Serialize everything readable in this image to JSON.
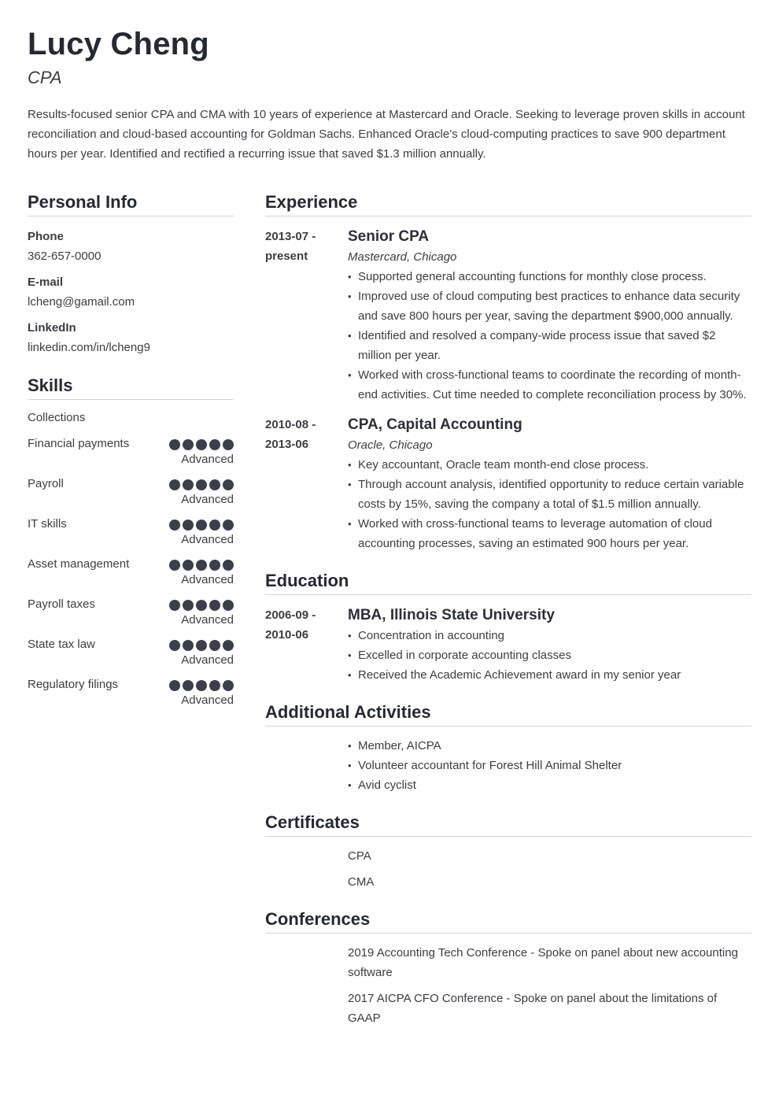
{
  "header": {
    "name": "Lucy Cheng",
    "title": "CPA",
    "summary": "Results-focused senior CPA and CMA with 10 years of experience at Mastercard and Oracle. Seeking to leverage proven skills in account reconciliation and cloud-based accounting for Goldman Sachs. Enhanced Oracle’s cloud-computing practices to save 900 department hours per year. Identified and rectified a recurring issue that saved $1.3 million annually."
  },
  "personal_info": {
    "heading": "Personal Info",
    "items": [
      {
        "label": "Phone",
        "value": "362-657-0000"
      },
      {
        "label": "E-mail",
        "value": "lcheng@gamail.com"
      },
      {
        "label": "LinkedIn",
        "value": "linkedin.com/in/lcheng9"
      }
    ]
  },
  "skills": {
    "heading": "Skills",
    "plain": [
      "Collections"
    ],
    "rated": [
      {
        "name": "Financial payments",
        "level": "Advanced",
        "rating": 5,
        "max": 5
      },
      {
        "name": "Payroll",
        "level": "Advanced",
        "rating": 5,
        "max": 5
      },
      {
        "name": "IT skills",
        "level": "Advanced",
        "rating": 5,
        "max": 5
      },
      {
        "name": "Asset management",
        "level": "Advanced",
        "rating": 5,
        "max": 5
      },
      {
        "name": "Payroll taxes",
        "level": "Advanced",
        "rating": 5,
        "max": 5
      },
      {
        "name": "State tax law",
        "level": "Advanced",
        "rating": 5,
        "max": 5
      },
      {
        "name": "Regulatory filings",
        "level": "Advanced",
        "rating": 5,
        "max": 5
      }
    ]
  },
  "experience": {
    "heading": "Experience",
    "entries": [
      {
        "date_start": "2013-07 -",
        "date_end": "present",
        "title": "Senior CPA",
        "subtitle": "Mastercard, Chicago",
        "bullets": [
          "Supported general accounting functions for monthly close process.",
          "Improved use of cloud computing best practices to enhance data security and save 800 hours per year, saving the department $900,000 annually.",
          "Identified and resolved a company-wide process issue that saved $2 million per year.",
          "Worked with cross-functional teams to coordinate the recording of month-end activities. Cut time needed to complete reconciliation process by 30%."
        ]
      },
      {
        "date_start": "2010-08 -",
        "date_end": "2013-06",
        "title": "CPA, Capital Accounting",
        "subtitle": "Oracle, Chicago",
        "bullets": [
          "Key accountant, Oracle team month-end close process.",
          "Through account analysis, identified opportunity to reduce certain variable costs by 15%, saving the company a total of $1.5 million annually.",
          "Worked with cross-functional teams to leverage automation of cloud accounting processes, saving an estimated 900 hours per year."
        ]
      }
    ]
  },
  "education": {
    "heading": "Education",
    "entries": [
      {
        "date_start": "2006-09 -",
        "date_end": "2010-06",
        "title": "MBA, Illinois State University",
        "bullets": [
          "Concentration in accounting",
          "Excelled in corporate accounting classes",
          "Received the Academic Achievement award in my senior year"
        ]
      }
    ]
  },
  "activities": {
    "heading": "Additional Activities",
    "bullets": [
      "Member, AICPA",
      "Volunteer accountant for Forest Hill Animal Shelter",
      "Avid cyclist"
    ]
  },
  "certificates": {
    "heading": "Certificates",
    "items": [
      "CPA",
      "CMA"
    ]
  },
  "conferences": {
    "heading": "Conferences",
    "items": [
      "2019 Accounting Tech Conference - Spoke on panel about new accounting software",
      "2017 AICPA CFO Conference - Spoke on panel about the limitations of GAAP"
    ]
  }
}
